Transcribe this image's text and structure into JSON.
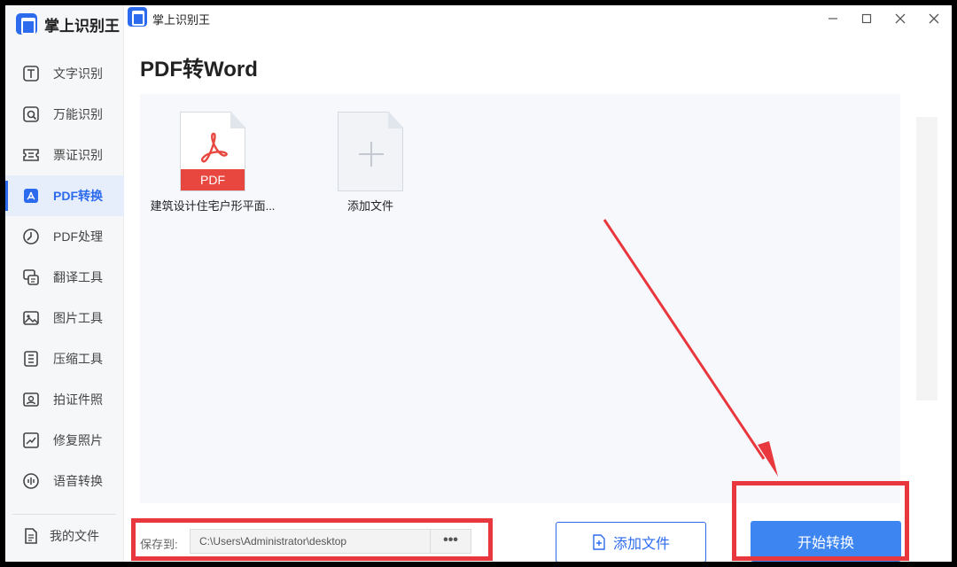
{
  "app": {
    "name": "掌上识别王",
    "window_title": "掌上识别王"
  },
  "sidebar": {
    "items": [
      {
        "label": "文字识别",
        "icon": "text-recognition-icon",
        "active": false
      },
      {
        "label": "万能识别",
        "icon": "universal-scan-icon",
        "active": false
      },
      {
        "label": "票证识别",
        "icon": "ticket-icon",
        "active": false
      },
      {
        "label": "PDF转换",
        "icon": "pdf-convert-icon",
        "active": true
      },
      {
        "label": "PDF处理",
        "icon": "pdf-process-icon",
        "active": false
      },
      {
        "label": "翻译工具",
        "icon": "translate-icon",
        "active": false
      },
      {
        "label": "图片工具",
        "icon": "image-icon",
        "active": false
      },
      {
        "label": "压缩工具",
        "icon": "compress-icon",
        "active": false
      },
      {
        "label": "拍证件照",
        "icon": "id-photo-icon",
        "active": false
      },
      {
        "label": "修复照片",
        "icon": "photo-repair-icon",
        "active": false
      },
      {
        "label": "语音转换",
        "icon": "voice-icon",
        "active": false
      }
    ],
    "my_files": "我的文件"
  },
  "main": {
    "title": "PDF转Word",
    "files": [
      {
        "name": "建筑设计住宅户形平面...",
        "type_badge": "PDF"
      },
      {
        "name": "添加文件",
        "type_badge": ""
      }
    ]
  },
  "footer": {
    "save_label": "保存到:",
    "save_path": "C:\\Users\\Administrator\\desktop",
    "browse_label": "•••",
    "add_file_label": "添加文件",
    "start_label": "开始转换"
  },
  "colors": {
    "accent": "#2c6bed",
    "start_button": "#3d86f2",
    "pdf_badge": "#e8473f",
    "annotation": "#e8383d"
  }
}
